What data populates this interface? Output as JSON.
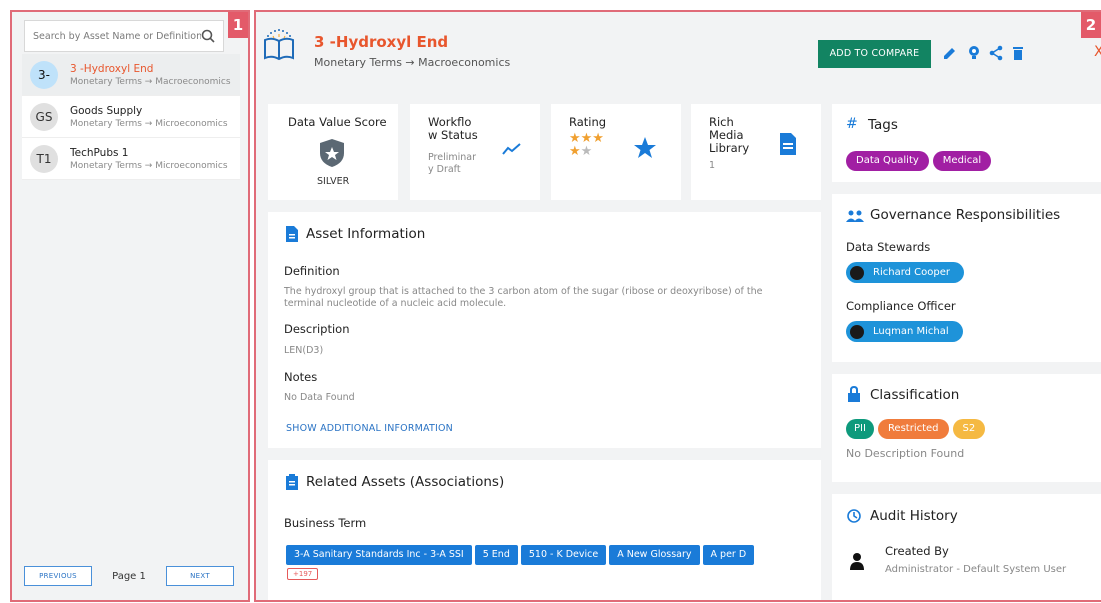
{
  "annotations": {
    "left_badge": "1",
    "right_badge": "2"
  },
  "search": {
    "placeholder": "Search by Asset Name or Definition"
  },
  "assets": [
    {
      "initials": "3-",
      "name": "3 -Hydroxyl End",
      "path": "Monetary Terms → Macroeconomics"
    },
    {
      "initials": "GS",
      "name": "Goods Supply",
      "path": "Monetary Terms → Microeconomics"
    },
    {
      "initials": "T1",
      "name": "TechPubs 1",
      "path": "Monetary Terms → Microeconomics"
    }
  ],
  "pager": {
    "previous": "PREVIOUS",
    "page_label": "Page 1",
    "next": "NEXT"
  },
  "header": {
    "title": "3 -Hydroxyl End",
    "breadcrumb": "Monetary Terms → Macroeconomics",
    "compare_button": "ADD TO COMPARE",
    "close": "X"
  },
  "metrics": {
    "dvs": {
      "title": "Data Value Score",
      "value": "SILVER"
    },
    "workflow": {
      "title_l1": "Workflo",
      "title_l2": "w Status",
      "value_l1": "Preliminar",
      "value_l2": "y Draft"
    },
    "rating": {
      "title": "Rating",
      "stars_filled": 3,
      "stars_total": 5
    },
    "rich": {
      "title_l1": "Rich",
      "title_l2": "Media",
      "title_l3": "Library",
      "value": "1"
    }
  },
  "asset_info": {
    "title": "Asset Information",
    "definition_label": "Definition",
    "definition_l1": "The hydroxyl group that is attached to the 3 carbon atom of the sugar (ribose or deoxyribose) of the",
    "definition_l2": "terminal nucleotide of a nucleic acid molecule.",
    "description_label": "Description",
    "description": "LEN(D3)",
    "notes_label": "Notes",
    "notes": "No Data Found",
    "show_more": "SHOW ADDITIONAL INFORMATION"
  },
  "related": {
    "title": "Related Assets (Associations)",
    "group_label": "Business Term",
    "chips": [
      "3-A Sanitary Standards Inc - 3-A SSI",
      "5 End",
      "510 - K Device",
      "A New Glossary",
      "A per D"
    ],
    "more": "+197"
  },
  "tags": {
    "title": "Tags",
    "items": [
      {
        "label": "Data Quality",
        "color": "#a11fa3"
      },
      {
        "label": "Medical",
        "color": "#a11fa3"
      }
    ]
  },
  "governance": {
    "title": "Governance Responsibilities",
    "stewards_label": "Data Stewards",
    "steward": "Richard Cooper",
    "compliance_label": "Compliance Officer",
    "compliance": "Luqman Michal"
  },
  "classification": {
    "title": "Classification",
    "pills": [
      {
        "label": "PII",
        "color": "#0e9a7c"
      },
      {
        "label": "Restricted",
        "color": "#f07c3c"
      },
      {
        "label": "S2",
        "color": "#f5b942"
      }
    ],
    "description": "No Description Found"
  },
  "audit": {
    "title": "Audit History",
    "created_label": "Created By",
    "created_by": "Administrator - Default System User"
  },
  "colors": {
    "accent": "#e8562d",
    "primary_blue": "#1a7bd8",
    "green": "#128462",
    "frame": "#e06b78"
  }
}
